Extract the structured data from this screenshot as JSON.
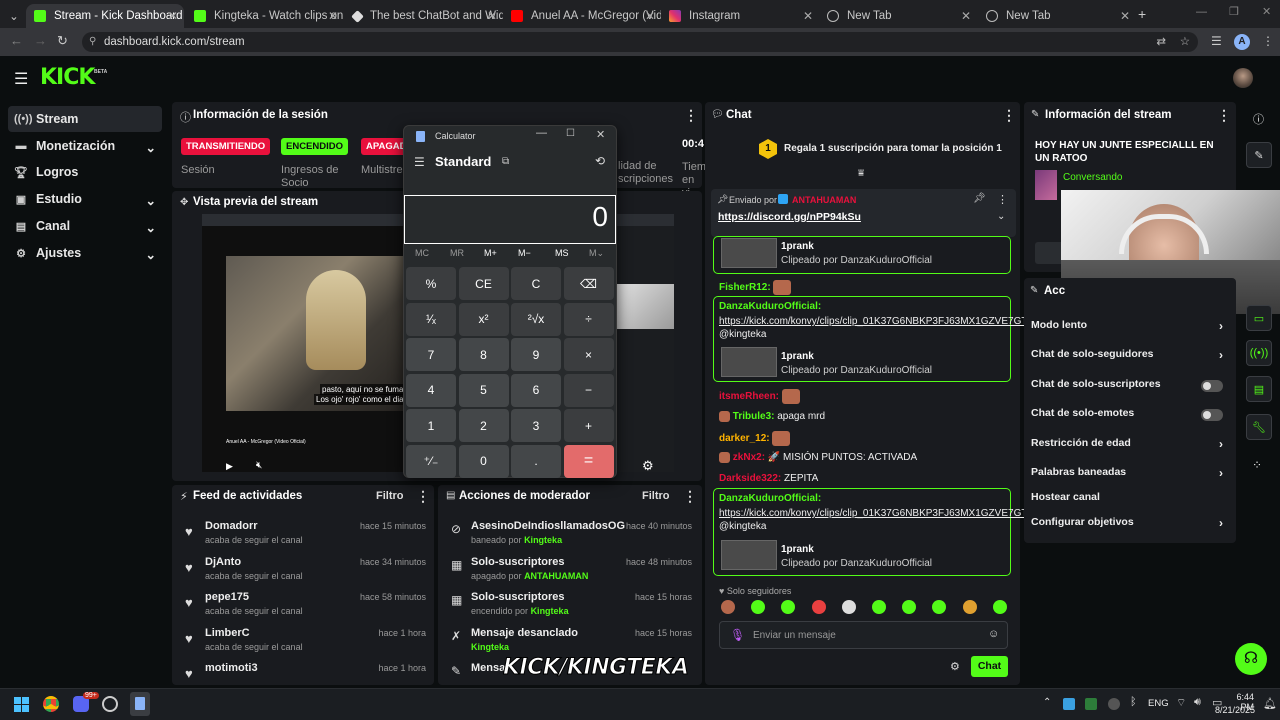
{
  "colors": {
    "accent": "#53fc18",
    "danger": "#e9113c",
    "eq": "#e36b6b"
  },
  "browser": {
    "tabs": [
      {
        "label": "Stream - Kick Dashboard",
        "icon": "kick-icon"
      },
      {
        "label": "Kingteka - Watch clips on Kick",
        "icon": "kick-icon"
      },
      {
        "label": "The best ChatBot and Widgets",
        "icon": "widget-icon"
      },
      {
        "label": "Anuel AA - McGregor (Video O",
        "icon": "youtube-icon"
      },
      {
        "label": "Instagram",
        "icon": "instagram-icon"
      },
      {
        "label": "New Tab",
        "icon": "globe-icon"
      },
      {
        "label": "New Tab",
        "icon": "globe-icon"
      }
    ],
    "url": "dashboard.kick.com/stream",
    "profile": "A"
  },
  "header": {
    "logo": "KICK",
    "beta": "BETA"
  },
  "sidebar": {
    "items": [
      {
        "label": "Stream",
        "icon": "stream-icon"
      },
      {
        "label": "Monetización",
        "icon": "money-icon"
      },
      {
        "label": "Logros",
        "icon": "trophy-icon"
      },
      {
        "label": "Estudio",
        "icon": "studio-icon"
      },
      {
        "label": "Canal",
        "icon": "channel-icon"
      },
      {
        "label": "Ajustes",
        "icon": "settings-icon"
      }
    ]
  },
  "session": {
    "title": "Información de la sesión",
    "badges": [
      "TRANSMITIENDO",
      "ENCENDIDO",
      "APAGADO"
    ],
    "labels": [
      "Sesión",
      "Ingresos de",
      "Socio",
      "Multistre",
      "lidad de",
      "scripciones",
      "00:4",
      "Tiem",
      "en vi"
    ]
  },
  "preview": {
    "title": "Vista previa del stream",
    "subtitle1": "pasto, aquí no se fuma",
    "subtitle2": "Los ojo' rojo' como el dial",
    "video_title": "Anuel AA - McGregor (Video Oficial)",
    "overlay": "KICK/KINGTEKA"
  },
  "calculator": {
    "title": "Calculator",
    "mode": "Standard",
    "display": "0",
    "memory": [
      "MC",
      "MR",
      "M+",
      "M−",
      "MS",
      "M⌄"
    ],
    "keys": [
      "%",
      "CE",
      "C",
      "⌫",
      "¹⁄ₓ",
      "x²",
      "²√x",
      "÷",
      "7",
      "8",
      "9",
      "×",
      "4",
      "5",
      "6",
      "−",
      "1",
      "2",
      "3",
      "+",
      "⁺⁄₋",
      "0",
      ".",
      "="
    ]
  },
  "feed": {
    "title": "Feed de actividades",
    "filter": "Filtro",
    "items": [
      {
        "name": "Domadorr",
        "sub": "acaba de seguir el canal",
        "time": "hace 15 minutos"
      },
      {
        "name": "DjAnto",
        "sub": "acaba de seguir el canal",
        "time": "hace 34 minutos"
      },
      {
        "name": "pepe175",
        "sub": "acaba de seguir el canal",
        "time": "hace 58 minutos"
      },
      {
        "name": "LimberC",
        "sub": "acaba de seguir el canal",
        "time": "hace 1 hora"
      },
      {
        "name": "motimoti3",
        "sub": "",
        "time": "hace 1 hora"
      }
    ]
  },
  "mod": {
    "title": "Acciones de moderador",
    "filter": "Filtro",
    "items": [
      {
        "name": "AsesinoDeIndiosllamadosOG",
        "pre": "baneado por",
        "by": "Kingteka",
        "time": "hace 40 minutos"
      },
      {
        "name": "Solo-suscriptores",
        "pre": "apagado por",
        "by": "ANTAHUAMAN",
        "time": "hace 48 minutos"
      },
      {
        "name": "Solo-suscriptores",
        "pre": "encendido por",
        "by": "Kingteka",
        "time": "hace 15 horas"
      },
      {
        "name": "Mensaje desanclado",
        "pre": "",
        "by": "Kingteka",
        "time": "hace 15 horas"
      },
      {
        "name": "Mensaj",
        "pre": "",
        "by": "",
        "time": ""
      }
    ]
  },
  "chat": {
    "title": "Chat",
    "gift": "Regala 1 suscripción para tomar la posición 1",
    "gift_rank": "1",
    "pinned": {
      "label": "Enviado por",
      "user": "ANTAHUAMAN",
      "link": "https://discord.gg/nPP94kSu"
    },
    "clip_title": "1prank",
    "clip_by": "Clipeado por DanzaKuduroOfficial",
    "clip_user": "DanzaKuduroOfficial:",
    "clip_link": "https://kick.com/konvy/clips/clip_01K37G6NBKP3FJ63MX1GZVE7GT",
    "clip_mention": "@kingteka",
    "messages": [
      {
        "user": "FisherR12:",
        "text": "",
        "color": "#53fc18"
      },
      {
        "user": "itsmeRheen:",
        "text": "",
        "color": "#e9113c"
      },
      {
        "user": "Tribule3:",
        "text": "apaga mrd",
        "color": "#53fc18"
      },
      {
        "user": "darker_12:",
        "text": "",
        "color": "#ffb300"
      },
      {
        "user": "zkNx2:",
        "text": "🚀 MISIÓN PUNTOS: ACTIVADA",
        "color": "#e9113c"
      },
      {
        "user": "Darkside322:",
        "text": "ZEPITA",
        "color": "#e9113c"
      }
    ],
    "mode_label": "Solo seguidores",
    "input_placeholder": "Enviar un mensaje",
    "send": "Chat"
  },
  "stream_info": {
    "title": "Información del stream",
    "stream_title": "HOY HAY UN JUNTE ESPECIALLL EN UN RATOO",
    "category": "Conversando"
  },
  "settings": {
    "header": "Acc",
    "rows": [
      {
        "label": "Modo lento",
        "type": "chevron"
      },
      {
        "label": "Chat de solo-seguidores",
        "type": "chevron"
      },
      {
        "label": "Chat de solo-suscriptores",
        "type": "toggle"
      },
      {
        "label": "Chat de solo-emotes",
        "type": "toggle"
      },
      {
        "label": "Restricción de edad",
        "type": "chevron"
      },
      {
        "label": "Palabras baneadas",
        "type": "chevron"
      },
      {
        "label": "Hostear canal",
        "type": "none"
      },
      {
        "label": "Configurar objetivos",
        "type": "chevron"
      }
    ]
  },
  "taskbar": {
    "lang": "ENG",
    "time": "6:44 PM",
    "date": "8/21/2025",
    "badge": "99+"
  }
}
